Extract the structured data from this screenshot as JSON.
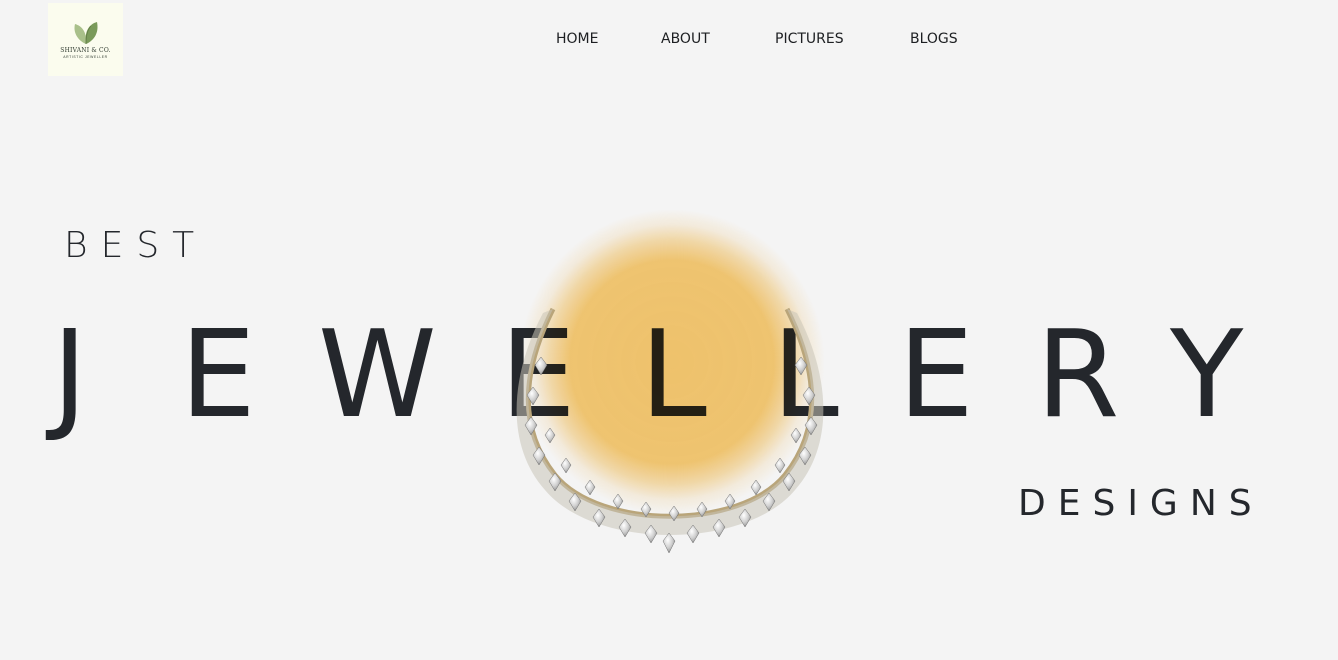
{
  "brand": {
    "name": "SHIVANI & CO.",
    "tagline": "ARTISTIC JEWELLER"
  },
  "nav": {
    "items": [
      {
        "label": "HOME"
      },
      {
        "label": "ABOUT"
      },
      {
        "label": "PICTURES"
      },
      {
        "label": "BLOGS"
      }
    ]
  },
  "hero": {
    "line1": "BEST",
    "word_letters": [
      "J",
      "E",
      "W",
      "E",
      "L",
      "L",
      "E",
      "R",
      "Y"
    ],
    "line3": "DESIGNS"
  },
  "colors": {
    "background": "#f4f4f4",
    "text": "#24272c",
    "glow": "#f9c869",
    "logo_bg": "#fbfcee",
    "leaf": "#7a9a5a"
  }
}
